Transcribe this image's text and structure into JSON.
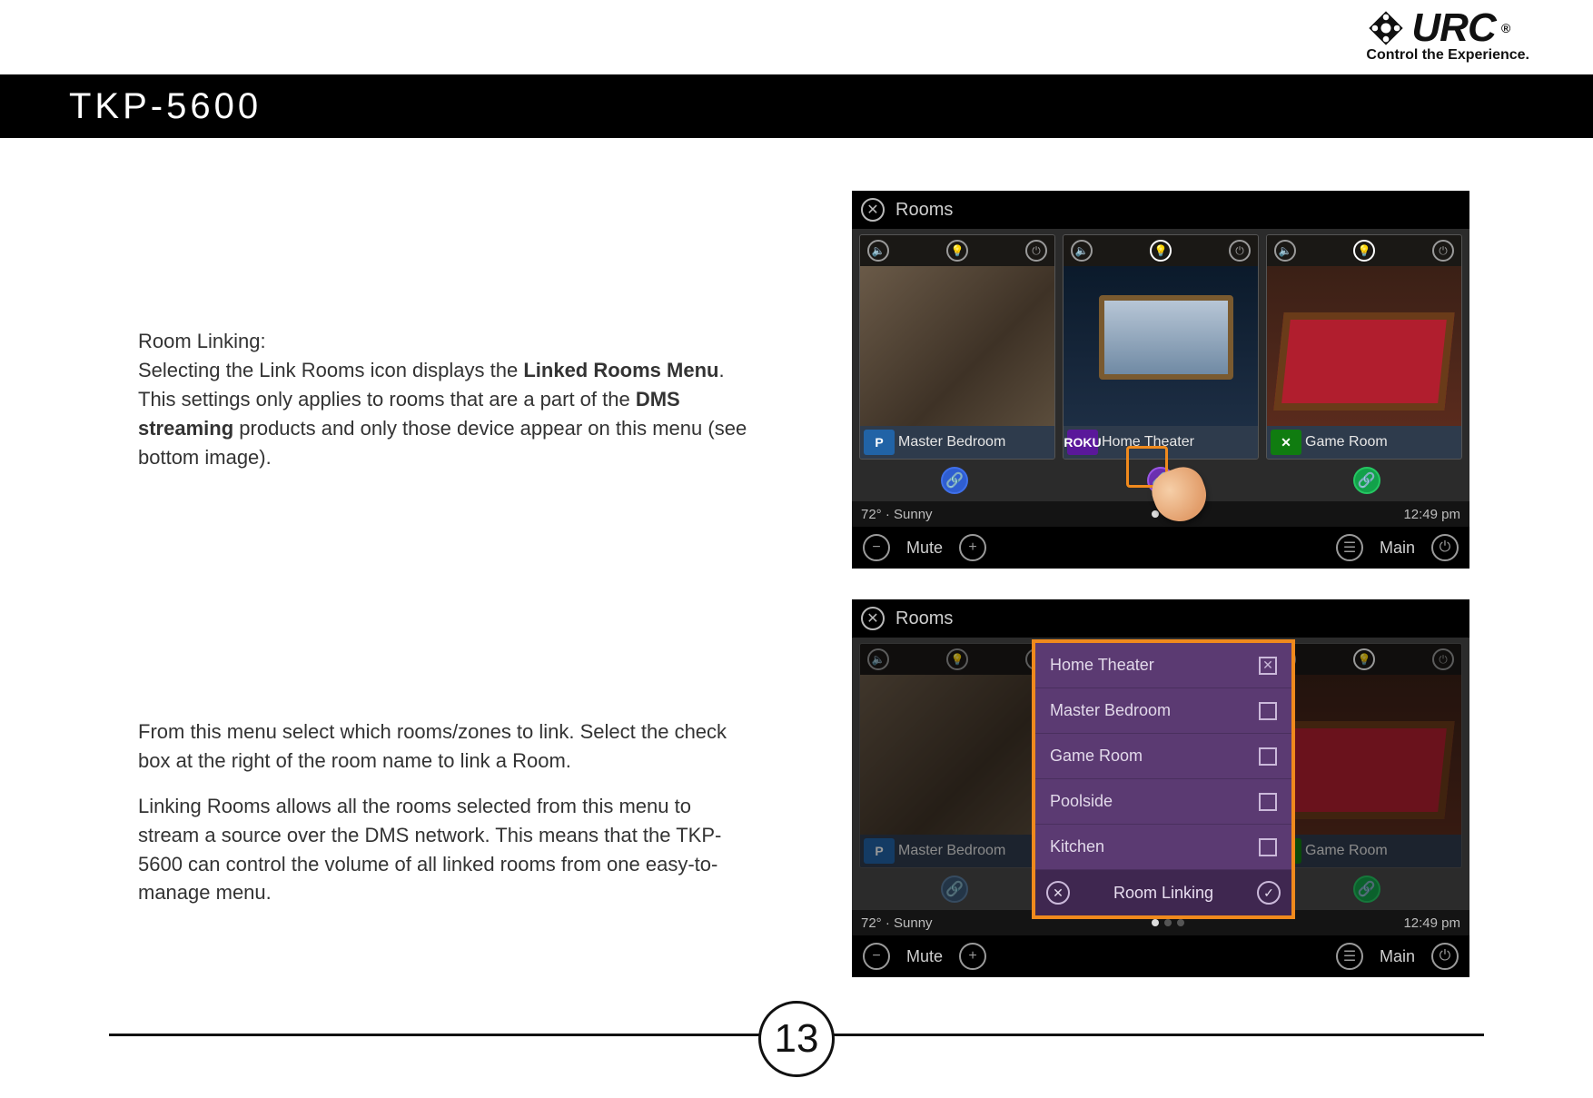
{
  "brand": {
    "name": "URC",
    "tagline": "Control the Experience.",
    "registered": "®"
  },
  "title_bar": {
    "model": "TKP-5600"
  },
  "section1": {
    "heading": "Room Linking:",
    "body_pre": "Selecting the Link Rooms icon displays the ",
    "body_bold1": "Linked Rooms Menu",
    "body_mid": ". This settings only applies to rooms that are a part of the ",
    "body_bold2": "DMS streaming",
    "body_post": " products and only those device appear on this menu (see bottom image)."
  },
  "section2": {
    "p1": "From this menu select which rooms/zones to link. Select the check box at the right of the room name to link a Room.",
    "p2": "Linking Rooms allows all the rooms selected from this menu to stream a source over the DMS network. This means that the TKP-5600 can control the volume of all linked rooms from one easy-to-manage menu."
  },
  "screenshot_common": {
    "header": "Rooms",
    "weather": "72° · Sunny",
    "clock": "12:49 pm",
    "mute": "Mute",
    "main": "Main"
  },
  "rooms": [
    {
      "name": "Master Bedroom",
      "service": "P",
      "service_name": "pandora"
    },
    {
      "name": "Home Theater",
      "service": "ROKU",
      "service_name": "roku"
    },
    {
      "name": "Game Room",
      "service": "✕",
      "service_name": "xbox"
    }
  ],
  "popup": {
    "title": "Room Linking",
    "items": [
      {
        "label": "Home Theater",
        "checked": true
      },
      {
        "label": "Master Bedroom",
        "checked": false
      },
      {
        "label": "Game Room",
        "checked": false
      },
      {
        "label": "Poolside",
        "checked": false
      },
      {
        "label": "Kitchen",
        "checked": false
      }
    ]
  },
  "page_number": "13"
}
